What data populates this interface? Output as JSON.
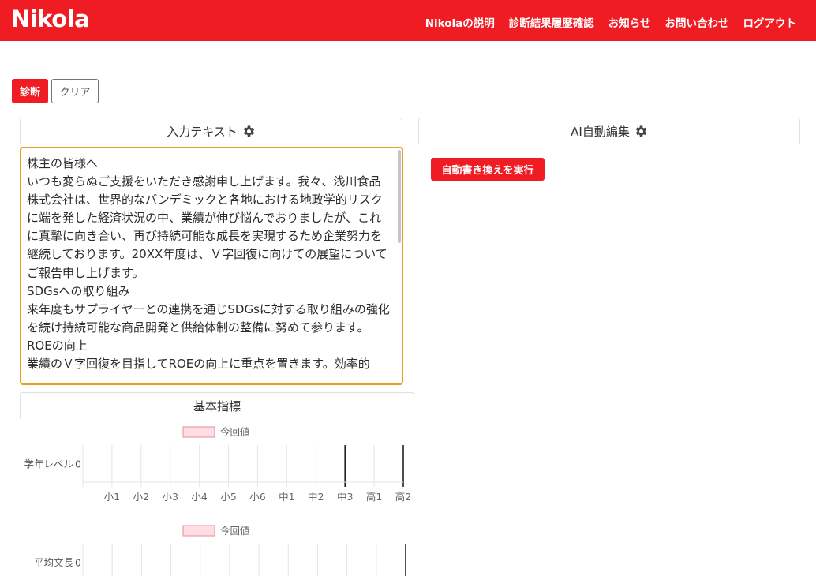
{
  "navbar": {
    "brand": "Nikola",
    "links": [
      "Nikolaの説明",
      "診断結果履歴確認",
      "お知らせ",
      "お問い合わせ",
      "ログアウト"
    ]
  },
  "toolbar": {
    "diagnose_label": "診断",
    "clear_label": "クリア"
  },
  "input_panel": {
    "title": "入力テキスト",
    "text": "株主の皆様へ\nいつも変らぬご支援をいただき感謝申し上げます。我々、浅川食品株式会社は、世界的なパンデミックと各地における地政学的リスクに端を発した経済状況の中、業績が伸び悩んでおりましたが、これに真摯に向き合い、再び持続可能な成長を実現するため企業努力を継続しております。20XX年度は、Ｖ字回復に向けての展望についてご報告申し上げます。\nSDGsへの取り組み\n来年度もサプライヤーとの連携を通じSDGsに対する取り組みの強化を続け持続可能な商品開発と供給体制の整備に努めて参ります。\nROEの向上\n業績のＶ字回復を目指してROEの向上に重点を置きます。効率的"
  },
  "ai_panel": {
    "title": "AI自動編集",
    "rewrite_label": "自動書き換えを実行"
  },
  "basic_panel": {
    "title": "基本指標"
  },
  "colors": {
    "brand": "#f01c24",
    "focus_border": "#e4a21f",
    "legend_fill": "#ffdde3",
    "legend_stroke": "#e8899b"
  },
  "icons": {
    "settings": "gear-icon"
  },
  "chart_data": [
    {
      "type": "bar",
      "orientation": "horizontal",
      "categories": [
        "学年レベル"
      ],
      "series": [
        {
          "name": "今回値",
          "values": [
            0
          ]
        }
      ],
      "value_label": "0",
      "x_ticks": [
        "小1",
        "小2",
        "小3",
        "小4",
        "小5",
        "小6",
        "中1",
        "中2",
        "中3",
        "高1",
        "高2"
      ],
      "highlight_tick": "中3",
      "legend": "top-center",
      "grid": true
    },
    {
      "type": "bar",
      "orientation": "horizontal",
      "categories": [
        "平均文長"
      ],
      "series": [
        {
          "name": "今回値",
          "values": [
            0
          ]
        }
      ],
      "value_label": "0",
      "legend": "top-center",
      "grid": true
    }
  ]
}
